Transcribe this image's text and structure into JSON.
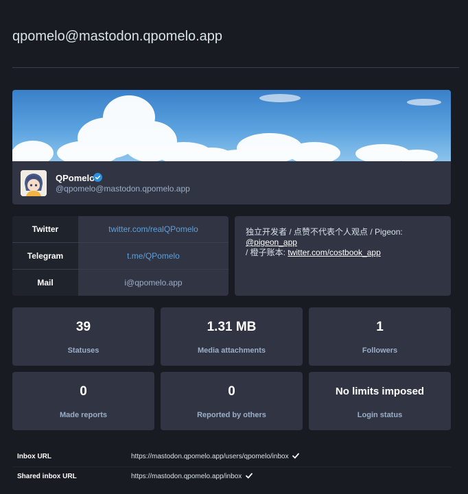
{
  "page": {
    "title": "qpomelo@mastodon.qpomelo.app"
  },
  "account": {
    "display_name": "QPomelo",
    "handle": "@qpomelo@mastodon.qpomelo.app",
    "verified_icon": "verified-badge-icon",
    "avatar_icon": "anime-avatar"
  },
  "fields": [
    {
      "name": "Twitter",
      "value": "twitter.com/realQPomelo"
    },
    {
      "name": "Telegram",
      "value": "t.me/QPomelo"
    },
    {
      "name": "Mail",
      "value": "i@qpomelo.app"
    }
  ],
  "bio": {
    "line1_prefix": "独立开发者 / 点赞不代表个人观点 / Pigeon: ",
    "line1_link": "@pigeon_app",
    "line2_prefix": "/ 橙子账本: ",
    "line2_link": "twitter.com/costbook_app"
  },
  "stats": [
    {
      "value": "39",
      "label": "Statuses"
    },
    {
      "value": "1.31 MB",
      "label": "Media attachments"
    },
    {
      "value": "1",
      "label": "Followers"
    },
    {
      "value": "0",
      "label": "Made reports"
    },
    {
      "value": "0",
      "label": "Reported by others"
    },
    {
      "value": "No limits imposed",
      "label": "Login status"
    }
  ],
  "info": [
    {
      "label": "Inbox URL",
      "value": "https://mastodon.qpomelo.app/users/qpomelo/inbox",
      "icon": "check-icon"
    },
    {
      "label": "Shared inbox URL",
      "value": "https://mastodon.qpomelo.app/inbox",
      "icon": "check-icon"
    }
  ],
  "colors": {
    "background": "#191b22",
    "card": "#313543",
    "accent_link": "#8c8dff",
    "verified": "#2b90d9"
  }
}
